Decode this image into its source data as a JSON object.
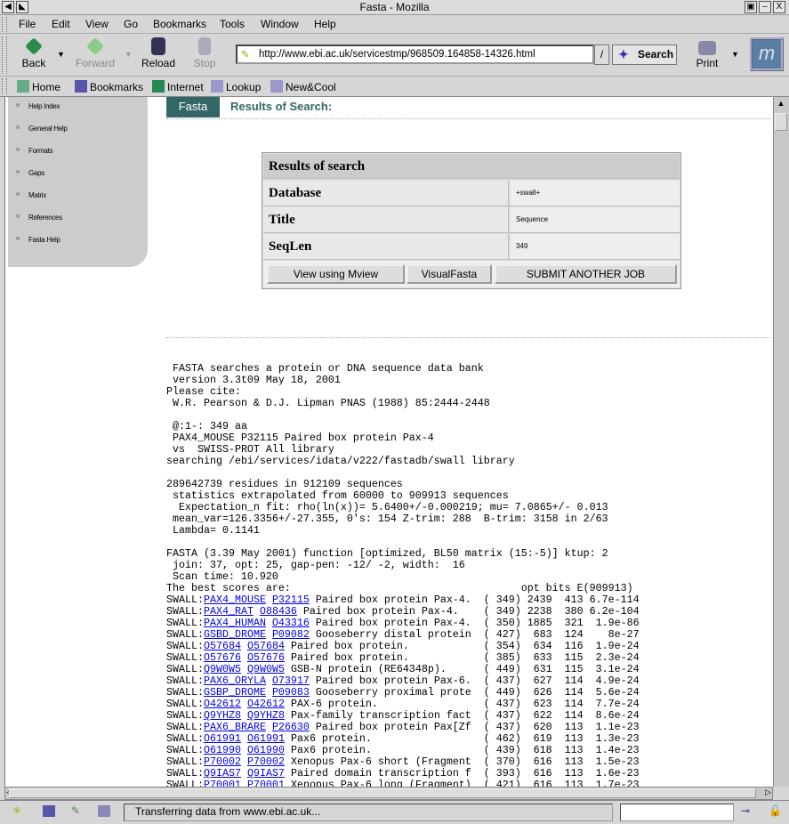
{
  "window": {
    "title": "Fasta - Mozilla"
  },
  "menu": [
    "File",
    "Edit",
    "View",
    "Go",
    "Bookmarks",
    "Tools",
    "Window",
    "Help"
  ],
  "nav": {
    "back": "Back",
    "forward": "Forward",
    "reload": "Reload",
    "stop": "Stop",
    "url": "http://www.ebi.ac.uk/servicestmp/968509.164858-14326.html",
    "search": "Search",
    "print": "Print"
  },
  "personal": [
    "Home",
    "Bookmarks",
    "Internet",
    "Lookup",
    "New&Cool"
  ],
  "sidebar": [
    "Help Index",
    "General Help",
    "Formats",
    "Gaps",
    "Matrix",
    "References",
    "Fasta Help"
  ],
  "page": {
    "tab": "Fasta",
    "heading": "Results of Search:"
  },
  "results_table": {
    "title": "Results of search",
    "rows": [
      {
        "label": "Database",
        "value": "+swall+"
      },
      {
        "label": "Title",
        "value": "Sequence"
      },
      {
        "label": "SeqLen",
        "value": "349"
      }
    ],
    "buttons": [
      "View using Mview",
      "VisualFasta",
      "SUBMIT ANOTHER JOB"
    ]
  },
  "output_lines": [
    " FASTA searches a protein or DNA sequence data bank",
    " version 3.3t09 May 18, 2001",
    "Please cite:",
    " W.R. Pearson & D.J. Lipman PNAS (1988) 85:2444-2448",
    "",
    " @:1-: 349 aa",
    " PAX4_MOUSE P32115 Paired box protein Pax-4",
    " vs  SWISS-PROT All library",
    "searching /ebi/services/idata/v222/fastadb/swall library",
    "",
    "289642739 residues in 912109 sequences",
    " statistics extrapolated from 60000 to 909913 sequences",
    "  Expectation_n fit: rho(ln(x))= 5.6400+/-0.000219; mu= 7.0865+/- 0.013",
    " mean_var=126.3356+/-27.355, 0's: 154 Z-trim: 288  B-trim: 3158 in 2/63",
    " Lambda= 0.1141",
    "",
    "FASTA (3.39 May 2001) function [optimized, BL50 matrix (15:-5)] ktup: 2",
    " join: 37, opt: 25, gap-pen: -12/ -2, width:  16",
    " Scan time: 10.920"
  ],
  "scores_header": {
    "label": "The best scores are:",
    "cols": "opt bits E(909913)"
  },
  "hits": [
    {
      "db": "SWALL:",
      "id": "PAX4_MOUSE",
      "acc": "P32115",
      "desc": "Paired box protein Pax-4.",
      "len": "349",
      "opt": "2439",
      "bits": "413",
      "e": "6.7e-114"
    },
    {
      "db": "SWALL:",
      "id": "PAX4_RAT",
      "acc": "O88436",
      "desc": "Paired box protein Pax-4.",
      "len": "349",
      "opt": "2238",
      "bits": "380",
      "e": "6.2e-104"
    },
    {
      "db": "SWALL:",
      "id": "PAX4_HUMAN",
      "acc": "O43316",
      "desc": "Paired box protein Pax-4.",
      "len": "350",
      "opt": "1885",
      "bits": "321",
      "e": "1.9e-86"
    },
    {
      "db": "SWALL:",
      "id": "GSBD_DROME",
      "acc": "P09082",
      "desc": "Gooseberry distal protein",
      "len": "427",
      "opt": "683",
      "bits": "124",
      "e": "8e-27"
    },
    {
      "db": "SWALL:",
      "id": "O57684",
      "acc": "O57684",
      "desc": "Paired box protein.",
      "len": "354",
      "opt": "634",
      "bits": "116",
      "e": "1.9e-24"
    },
    {
      "db": "SWALL:",
      "id": "O57676",
      "acc": "O57676",
      "desc": "Paired box protein.",
      "len": "385",
      "opt": "633",
      "bits": "115",
      "e": "2.3e-24"
    },
    {
      "db": "SWALL:",
      "id": "Q9W0W5",
      "acc": "Q9W0W5",
      "desc": "GSB-N protein (RE64348p).",
      "len": "449",
      "opt": "631",
      "bits": "115",
      "e": "3.1e-24"
    },
    {
      "db": "SWALL:",
      "id": "PAX6_ORYLA",
      "acc": "O73917",
      "desc": "Paired box protein Pax-6.",
      "len": "437",
      "opt": "627",
      "bits": "114",
      "e": "4.9e-24"
    },
    {
      "db": "SWALL:",
      "id": "GSBP_DROME",
      "acc": "P09083",
      "desc": "Gooseberry proximal prote",
      "len": "449",
      "opt": "626",
      "bits": "114",
      "e": "5.6e-24"
    },
    {
      "db": "SWALL:",
      "id": "O42612",
      "acc": "O42612",
      "desc": "PAX-6 protein.",
      "len": "437",
      "opt": "623",
      "bits": "114",
      "e": "7.7e-24"
    },
    {
      "db": "SWALL:",
      "id": "Q9YHZ8",
      "acc": "Q9YHZ8",
      "desc": "Pax-family transcription fact",
      "len": "437",
      "opt": "622",
      "bits": "114",
      "e": "8.6e-24"
    },
    {
      "db": "SWALL:",
      "id": "PAX6_BRARE",
      "acc": "P26630",
      "desc": "Paired box protein Pax[Zf",
      "len": "437",
      "opt": "620",
      "bits": "113",
      "e": "1.1e-23"
    },
    {
      "db": "SWALL:",
      "id": "O61991",
      "acc": "O61991",
      "desc": "Pax6 protein.",
      "len": "462",
      "opt": "619",
      "bits": "113",
      "e": "1.3e-23"
    },
    {
      "db": "SWALL:",
      "id": "O61990",
      "acc": "O61990",
      "desc": "Pax6 protein.",
      "len": "439",
      "opt": "618",
      "bits": "113",
      "e": "1.4e-23"
    },
    {
      "db": "SWALL:",
      "id": "P70002",
      "acc": "P70002",
      "desc": "Xenopus Pax-6 short (Fragment",
      "len": "370",
      "opt": "616",
      "bits": "113",
      "e": "1.5e-23"
    },
    {
      "db": "SWALL:",
      "id": "Q9IAS7",
      "acc": "Q9IAS7",
      "desc": "Paired domain transcription f",
      "len": "393",
      "opt": "616",
      "bits": "113",
      "e": "1.6e-23"
    },
    {
      "db": "SWALL:",
      "id": "P70001",
      "acc": "P70001",
      "desc": "Xenopus Pax-6 long (Fragment)",
      "len": "421",
      "opt": "616",
      "bits": "113",
      "e": "1.7e-23"
    }
  ],
  "status": {
    "text": "Transferring data from www.ebi.ac.uk..."
  }
}
